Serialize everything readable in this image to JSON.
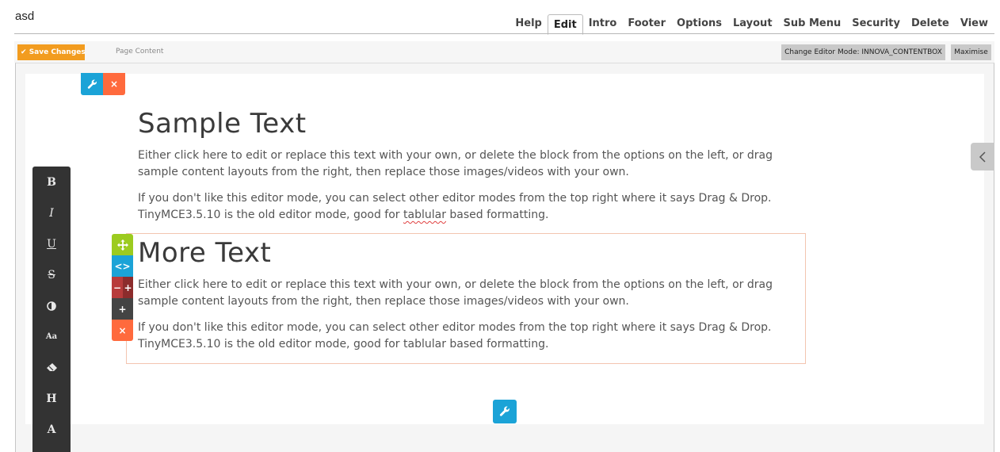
{
  "page": {
    "title": "asd"
  },
  "tabs": [
    {
      "label": "Help",
      "active": false
    },
    {
      "label": "Edit",
      "active": true
    },
    {
      "label": "Intro",
      "active": false
    },
    {
      "label": "Footer",
      "active": false
    },
    {
      "label": "Options",
      "active": false
    },
    {
      "label": "Layout",
      "active": false
    },
    {
      "label": "Sub Menu",
      "active": false
    },
    {
      "label": "Security",
      "active": false
    },
    {
      "label": "Delete",
      "active": false
    },
    {
      "label": "View",
      "active": false
    }
  ],
  "toolbar": {
    "save_label": "Save Changes",
    "save_icon": "check-icon",
    "breadcrumb": "Page Content",
    "mode_label": "Change Editor Mode: INNOVA_CONTENTBOX",
    "maximise_label": "Maximise"
  },
  "content": {
    "block1": {
      "heading": "Sample Text",
      "p1": "Either click here to edit or replace this text with your own, or delete the block from the options on the left, or drag sample content layouts from the right, then replace those images/videos with your own.",
      "p2_before": "If you don't like this editor mode, you can select other editor modes from the top right where it says Drag & Drop. TinyMCE3.5.10 is the old editor mode, good for ",
      "p2_misspelled": "tablular",
      "p2_after": " based formatting."
    },
    "block2": {
      "heading": "More Text",
      "p1": "Either click here to edit or replace this text with your own, or delete the block from the options on the left, or drag sample content layouts from the right, then replace those images/videos with your own.",
      "p2": "If you don't like this editor mode, you can select other editor modes from the top right where it says Drag & Drop. TinyMCE3.5.10 is the old editor mode, good for tablular based formatting."
    }
  },
  "format_bar": {
    "bold": "B",
    "italic": "I",
    "underline": "U",
    "strike": "S",
    "font_size": "Aa",
    "heading": "H",
    "font": "A"
  },
  "block_tools": {
    "minus": "−",
    "plus": "+",
    "add": "+",
    "close": "×"
  },
  "colors": {
    "accent_blue": "#1ba3d7",
    "accent_orange": "#f29c1f",
    "danger": "#ff6a3d",
    "move_green": "#9ccb1f"
  }
}
